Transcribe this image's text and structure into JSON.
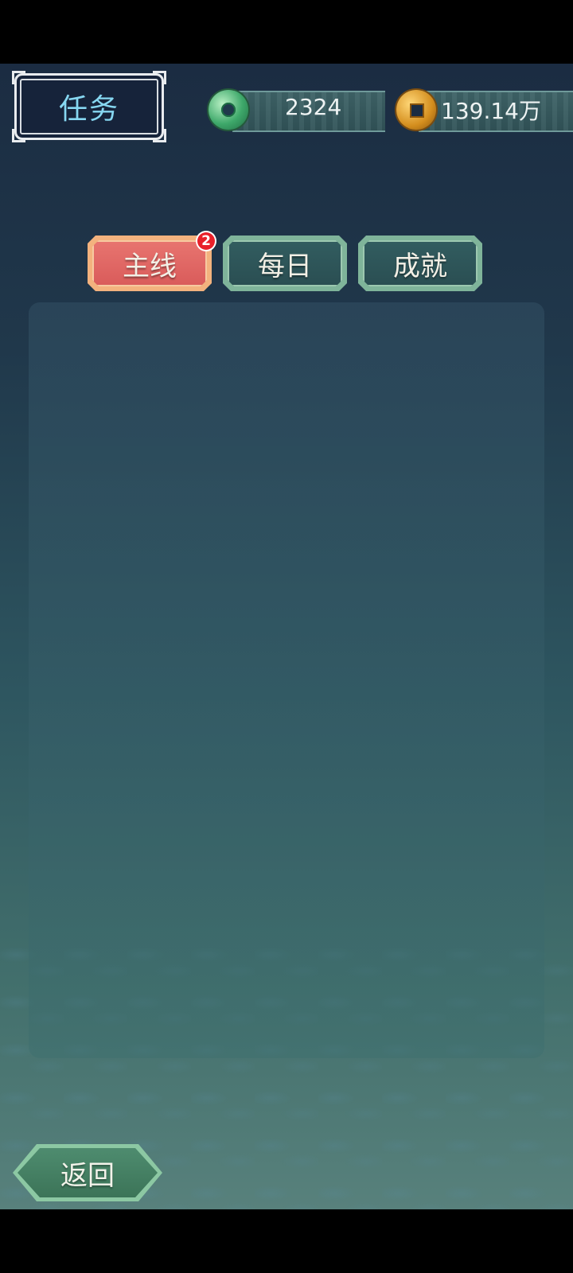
{
  "header": {
    "title": "任务"
  },
  "currencies": [
    {
      "icon": "jade-icon",
      "value": "2324"
    },
    {
      "icon": "coin-icon",
      "value": "139.14万"
    }
  ],
  "tabs": [
    {
      "label": "主线",
      "active": true,
      "badge": "2"
    },
    {
      "label": "每日",
      "active": false
    },
    {
      "label": "成就",
      "active": false
    }
  ],
  "footer": {
    "back_label": "返回"
  },
  "colors": {
    "title_text": "#86d7f1",
    "active_tab": "#d95b5a",
    "inactive_tab": "#2a4e52",
    "badge": "#e8202a"
  }
}
